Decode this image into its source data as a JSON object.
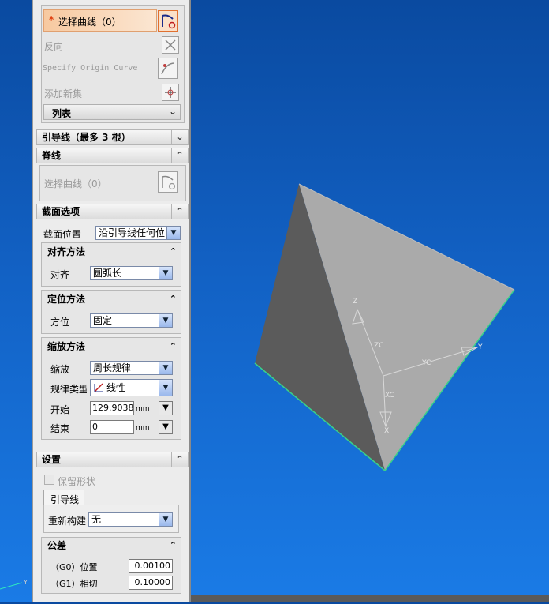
{
  "viewport": {
    "axes": {
      "z": "Z",
      "zc": "ZC",
      "y": "Y",
      "yc": "YC",
      "xc": "XC",
      "x": "X"
    },
    "corner_axis": "Y",
    "colors": {
      "bg_top": "#0a4aa0",
      "bg_bottom": "#1a7be6",
      "face_light": "#a9a9a9",
      "face_dark": "#5a5a5a",
      "edge": "#3ad18a"
    }
  },
  "panel": {
    "section_curve": {
      "select_curve": "选择曲线（0）",
      "required_mark": "*",
      "reverse": "反向",
      "specify_origin": "Specify Origin Curve",
      "add_new_set": "添加新集",
      "list": "列表"
    },
    "guides_header": "引导线（最多 3 根）",
    "spine": {
      "header": "脊线",
      "select_curve": "选择曲线（0）"
    },
    "section_options": {
      "header": "截面选项",
      "position_label": "截面位置",
      "position_value": "沿引导线任何位",
      "align": {
        "header": "对齐方法",
        "label": "对齐",
        "value": "圆弧长"
      },
      "orient": {
        "header": "定位方法",
        "label": "方位",
        "value": "固定"
      },
      "scale": {
        "header": "缩放方法",
        "scale_label": "缩放",
        "scale_value": "周长规律",
        "law_type_label": "规律类型",
        "law_type_value": "线性",
        "start_label": "开始",
        "start_value": "129.9038:",
        "start_unit": "mm",
        "end_label": "结束",
        "end_value": "0",
        "end_unit": "mm"
      }
    },
    "settings": {
      "header": "设置",
      "keep_shape": "保留形状",
      "tab": "引导线",
      "rebuild_label": "重新构建",
      "rebuild_value": "无",
      "tolerance": {
        "header": "公差",
        "g0_label": "（G0）位置",
        "g0_value": "0.00100",
        "g1_label": "（G1）相切",
        "g1_value": "0.10000"
      }
    }
  }
}
